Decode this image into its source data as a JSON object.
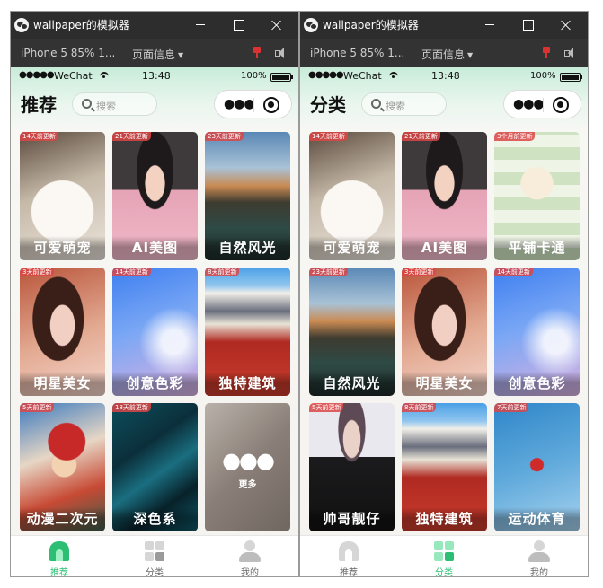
{
  "windows": [
    {
      "title": "wallpaper的模拟器",
      "toolbar": {
        "device": "iPhone 5 85% 1...",
        "page_info": "页面信息"
      },
      "status": {
        "dots": "●●●●●",
        "carrier": "WeChat",
        "time": "13:48",
        "battery": "100%"
      },
      "nav": {
        "title": "推荐",
        "search_placeholder": "搜索"
      },
      "cards": [
        {
          "label": "可爱萌宠",
          "badge": "14天前更新",
          "bg": "bg-cat"
        },
        {
          "label": "AI美图",
          "badge": "21天前更新",
          "bg": "bg-girl"
        },
        {
          "label": "自然风光",
          "badge": "23天前更新",
          "bg": "bg-mountain"
        },
        {
          "label": "明星美女",
          "badge": "3天前更新",
          "bg": "bg-star"
        },
        {
          "label": "创意色彩",
          "badge": "14天前更新",
          "bg": "bg-color"
        },
        {
          "label": "独特建筑",
          "badge": "8天前更新",
          "bg": "bg-building"
        },
        {
          "label": "动漫二次元",
          "badge": "5天前更新",
          "bg": "bg-anime"
        },
        {
          "label": "深色系",
          "badge": "18天前更新",
          "bg": "bg-dark"
        }
      ],
      "more_card": {
        "dots": "●●●",
        "label": "更多"
      },
      "tabs": [
        {
          "label": "推荐"
        },
        {
          "label": "分类"
        },
        {
          "label": "我的"
        }
      ],
      "active_tab": 0
    },
    {
      "title": "wallpaper的模拟器",
      "toolbar": {
        "device": "iPhone 5 85% 1...",
        "page_info": "页面信息"
      },
      "status": {
        "dots": "●●●●●",
        "carrier": "WeChat",
        "time": "13:48",
        "battery": "100%"
      },
      "nav": {
        "title": "分类",
        "search_placeholder": "搜索"
      },
      "cards": [
        {
          "label": "可爱萌宠",
          "badge": "14天前更新",
          "bg": "bg-cat"
        },
        {
          "label": "AI美图",
          "badge": "21天前更新",
          "bg": "bg-girl"
        },
        {
          "label": "平铺卡通",
          "badge": "3个月前更新",
          "bg": "bg-cartoon"
        },
        {
          "label": "自然风光",
          "badge": "23天前更新",
          "bg": "bg-mountain"
        },
        {
          "label": "明星美女",
          "badge": "3天前更新",
          "bg": "bg-star"
        },
        {
          "label": "创意色彩",
          "badge": "14天前更新",
          "bg": "bg-color"
        },
        {
          "label": "帅哥靓仔",
          "badge": "5天前更新",
          "bg": "bg-handsome"
        },
        {
          "label": "独特建筑",
          "badge": "8天前更新",
          "bg": "bg-building"
        },
        {
          "label": "运动体育",
          "badge": "7天前更新",
          "bg": "bg-sport"
        }
      ],
      "tabs": [
        {
          "label": "推荐"
        },
        {
          "label": "分类"
        },
        {
          "label": "我的"
        }
      ],
      "active_tab": 1
    }
  ],
  "colors": {
    "accent": "#2cbf73",
    "titlebar": "#2d2d2d",
    "toolbar": "#333333",
    "badge": "#dc4646"
  }
}
